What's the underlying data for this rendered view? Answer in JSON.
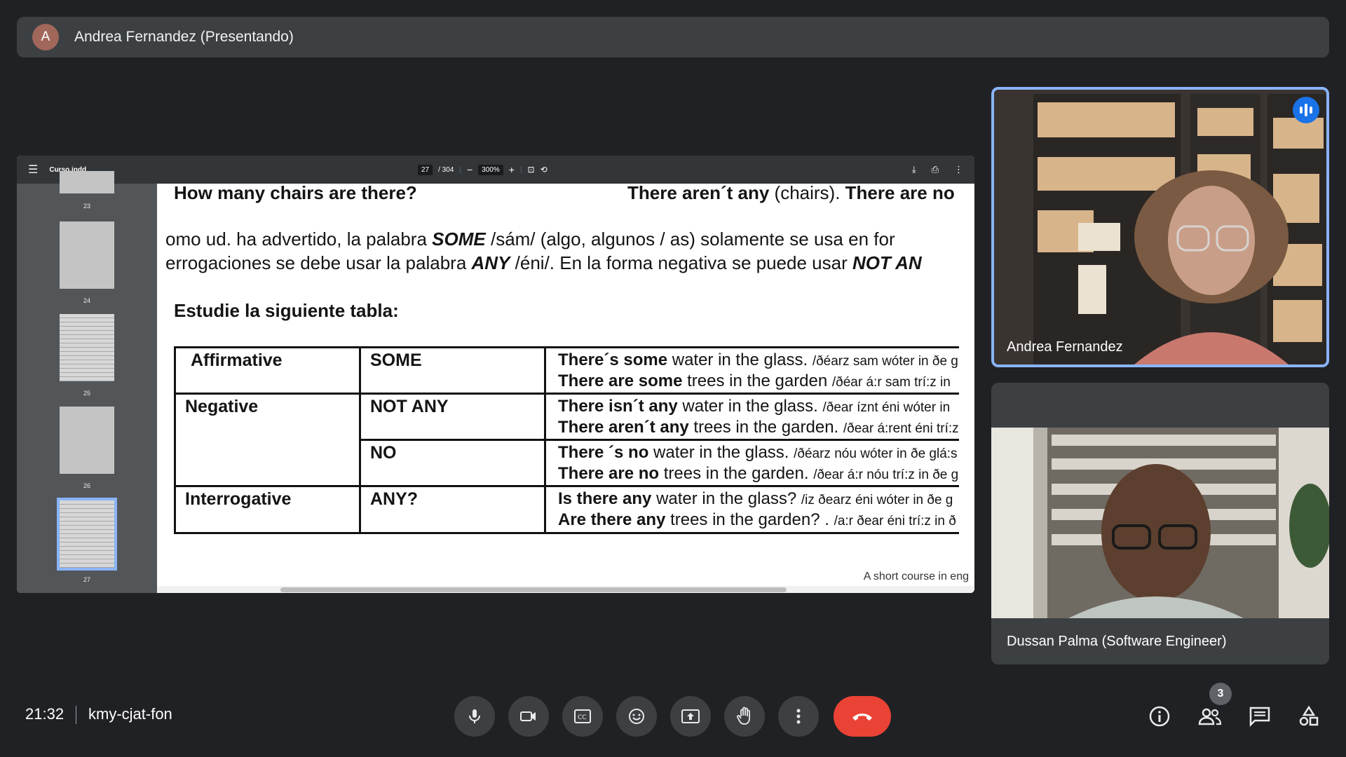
{
  "presenter_bar": {
    "avatar_letter": "A",
    "label": "Andrea Fernandez (Presentando)"
  },
  "viewer": {
    "file_name": "Curso.indd",
    "page_current": "27",
    "page_total": "/ 304",
    "zoom": "300%",
    "thumbnail_numbers": [
      "23",
      "24",
      "25",
      "26",
      "27"
    ],
    "selected_page": "27"
  },
  "document": {
    "question_line": "How many chairs are there?",
    "answer_line_a": "There aren´t any",
    "answer_line_b": "(chairs).",
    "answer_line_c": "There are no",
    "paragraph_1_a": "omo ud. ha advertido, la palabra",
    "paragraph_1_some": "SOME",
    "paragraph_1_b": "/sám/ (algo, algunos / as) solamente se usa en for",
    "paragraph_2_a": "errogaciones se debe usar la palabra",
    "paragraph_2_any": "ANY",
    "paragraph_2_b": "/éni/. En la forma negativa se puede usar",
    "paragraph_2_notany": "NOT AN",
    "table_heading": "Estudie la siguiente tabla:",
    "table": {
      "rows": [
        {
          "form": "Affirmative",
          "word": "SOME",
          "ex1_b": "There´s some",
          "ex1_t": " water in the glass. ",
          "ex1_p": "/ðéarz sam wóter in ðe g",
          "ex2_b": "There are some",
          "ex2_t": " trees in the garden ",
          "ex2_p": "/ðéar á:r sam trí:z in"
        },
        {
          "form": "Negative",
          "word": "NOT ANY",
          "ex1_b": "There isn´t any",
          "ex1_t": " water in the glass. ",
          "ex1_p": "/ðear íznt éni wóter in",
          "ex2_b": "There aren´t any",
          "ex2_t": " trees in the garden. ",
          "ex2_p": "/ðear á:rent éni trí:z"
        },
        {
          "form": "",
          "word": "NO",
          "ex1_b": "There ´s no",
          "ex1_t": " water in the glass. ",
          "ex1_p": "/ðéarz nóu wóter in ðe glá:s",
          "ex2_b": "There are no",
          "ex2_t": " trees in the garden. ",
          "ex2_p": "/ðear á:r nóu trí:z in ðe g"
        },
        {
          "form": "Interrogative",
          "word": "ANY?",
          "ex1_b": "Is there any",
          "ex1_t": " water in the glass? ",
          "ex1_p": "/iz ðearz éni wóter in ðe g",
          "ex2_b": "Are there any",
          "ex2_t": " trees in the garden? . ",
          "ex2_p": "/a:r ðear éni trí:z in ð"
        }
      ]
    },
    "footer_note": "A short course in eng"
  },
  "tiles": {
    "tile_a_name": "Andrea Fernandez",
    "tile_b_name": "Dussan Palma (Software Engineer)"
  },
  "bottom_bar": {
    "time": "21:32",
    "meeting_code": "kmy-cjat-fon",
    "participants_count": "3"
  },
  "colors": {
    "end_call": "#ea4335",
    "accent": "#8ab4f8",
    "speaking": "#1a73e8"
  }
}
